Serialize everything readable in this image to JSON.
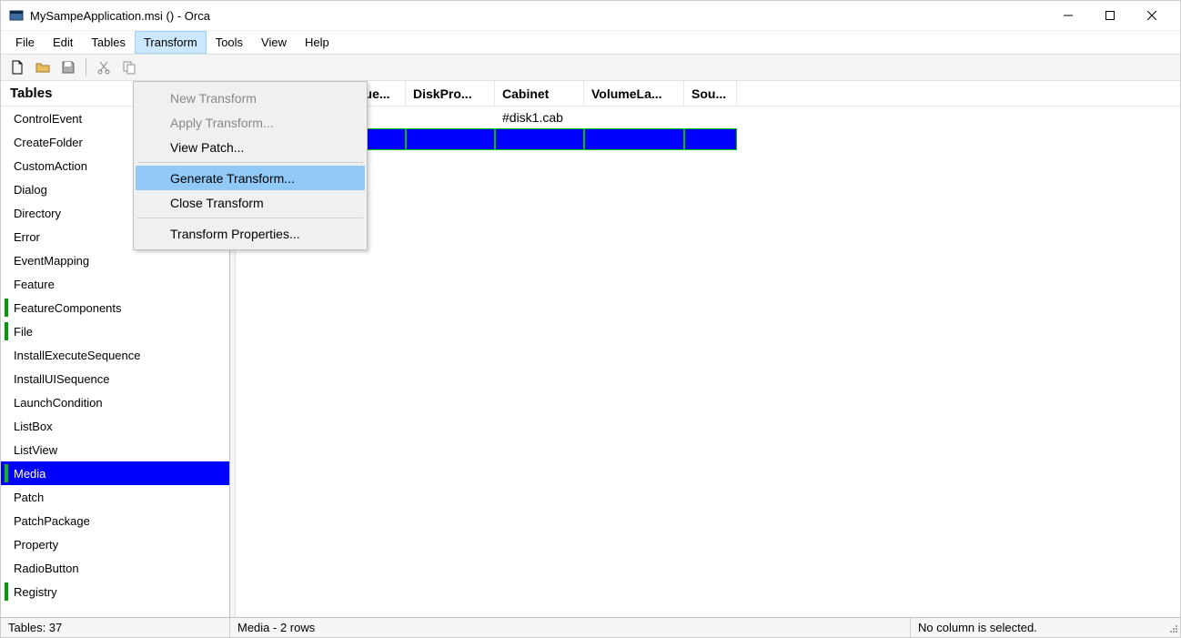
{
  "title": "MySampeApplication.msi () - Orca",
  "menu": {
    "items": [
      "File",
      "Edit",
      "Tables",
      "Transform",
      "Tools",
      "View",
      "Help"
    ],
    "open_index": 3
  },
  "dropdown": [
    {
      "label": "New Transform",
      "disabled": true
    },
    {
      "label": "Apply Transform...",
      "disabled": true
    },
    {
      "label": "View Patch...",
      "disabled": false
    },
    {
      "sep": true
    },
    {
      "label": "Generate Transform...",
      "disabled": false,
      "highlight": true
    },
    {
      "label": "Close Transform",
      "disabled": false
    },
    {
      "sep": true
    },
    {
      "label": "Transform Properties...",
      "disabled": false
    }
  ],
  "left": {
    "header": "Tables",
    "items": [
      {
        "label": "ControlEvent"
      },
      {
        "label": "CreateFolder"
      },
      {
        "label": "CustomAction"
      },
      {
        "label": "Dialog"
      },
      {
        "label": "Directory"
      },
      {
        "label": "Error"
      },
      {
        "label": "EventMapping"
      },
      {
        "label": "Feature"
      },
      {
        "label": "FeatureComponents",
        "mark": true
      },
      {
        "label": "File",
        "mark": true
      },
      {
        "label": "InstallExecuteSequence"
      },
      {
        "label": "InstallUISequence"
      },
      {
        "label": "LaunchCondition"
      },
      {
        "label": "ListBox"
      },
      {
        "label": "ListView"
      },
      {
        "label": "Media",
        "mark": true,
        "selected": true
      },
      {
        "label": "Patch"
      },
      {
        "label": "PatchPackage"
      },
      {
        "label": "Property"
      },
      {
        "label": "RadioButton"
      },
      {
        "label": "Registry",
        "mark": true
      }
    ]
  },
  "columns": [
    {
      "label": "",
      "width": 125
    },
    {
      "label": "que...",
      "width": 62
    },
    {
      "label": "DiskPro...",
      "width": 98
    },
    {
      "label": "Cabinet",
      "width": 98
    },
    {
      "label": "VolumeLa...",
      "width": 110
    },
    {
      "label": "Sou...",
      "width": 58
    }
  ],
  "rows": [
    {
      "cells": [
        "",
        "",
        "",
        "#disk1.cab",
        "",
        ""
      ],
      "selected": false
    },
    {
      "cells": [
        "",
        "",
        "",
        "",
        "",
        ""
      ],
      "selected": true
    }
  ],
  "status": {
    "left": "Tables: 37",
    "mid": "Media - 2 rows",
    "right": "No column is selected."
  }
}
